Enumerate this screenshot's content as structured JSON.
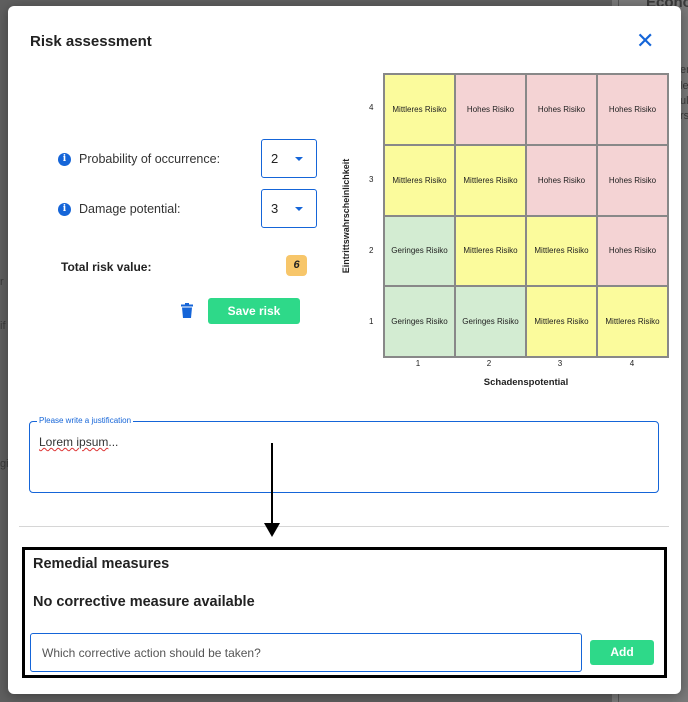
{
  "background": {
    "right_texts": [
      "Econo",
      "t",
      "en",
      "le",
      "ul",
      "rs"
    ],
    "left_texts": [
      "r",
      "if",
      "gi"
    ]
  },
  "modal": {
    "title": "Risk assessment",
    "close_icon": "close-icon"
  },
  "form": {
    "probability": {
      "label": "Probability of occurrence:",
      "value": "2"
    },
    "damage": {
      "label": "Damage potential:",
      "value": "3"
    },
    "total": {
      "label": "Total risk value:",
      "value": "6"
    },
    "save_label": "Save risk"
  },
  "matrix": {
    "y_label": "Eintrittswahrscheinlichkeit",
    "x_label": "Schadenspotential",
    "y_ticks": [
      "4",
      "3",
      "2",
      "1"
    ],
    "x_ticks": [
      "1",
      "2",
      "3",
      "4"
    ],
    "rows": [
      [
        {
          "text": "Mittleres Risiko",
          "level": "mid"
        },
        {
          "text": "Hohes Risiko",
          "level": "high"
        },
        {
          "text": "Hohes Risiko",
          "level": "high"
        },
        {
          "text": "Hohes Risiko",
          "level": "high"
        }
      ],
      [
        {
          "text": "Mittleres Risiko",
          "level": "mid"
        },
        {
          "text": "Mittleres Risiko",
          "level": "mid"
        },
        {
          "text": "Hohes Risiko",
          "level": "high"
        },
        {
          "text": "Hohes Risiko",
          "level": "high"
        }
      ],
      [
        {
          "text": "Geringes Risiko",
          "level": "low"
        },
        {
          "text": "Mittleres Risiko",
          "level": "mid"
        },
        {
          "text": "Mittleres Risiko",
          "level": "mid"
        },
        {
          "text": "Hohes Risiko",
          "level": "high"
        }
      ],
      [
        {
          "text": "Geringes Risiko",
          "level": "low"
        },
        {
          "text": "Geringes Risiko",
          "level": "low"
        },
        {
          "text": "Mittleres Risiko",
          "level": "mid"
        },
        {
          "text": "Mittleres Risiko",
          "level": "mid"
        }
      ]
    ]
  },
  "justification": {
    "legend": "Please write a justification",
    "text_word": "Lorem ipsum",
    "text_rest": "..."
  },
  "remedial": {
    "title": "Remedial measures",
    "empty_text": "No corrective measure available",
    "input_placeholder": "Which corrective action should be taken?",
    "add_label": "Add"
  },
  "colors": {
    "accent": "#1565d8",
    "button_green": "#2ed989",
    "badge": "#f7c66a",
    "risk_low": "#d3ecd2",
    "risk_mid": "#fbfb9c",
    "risk_high": "#f4d3d4"
  }
}
